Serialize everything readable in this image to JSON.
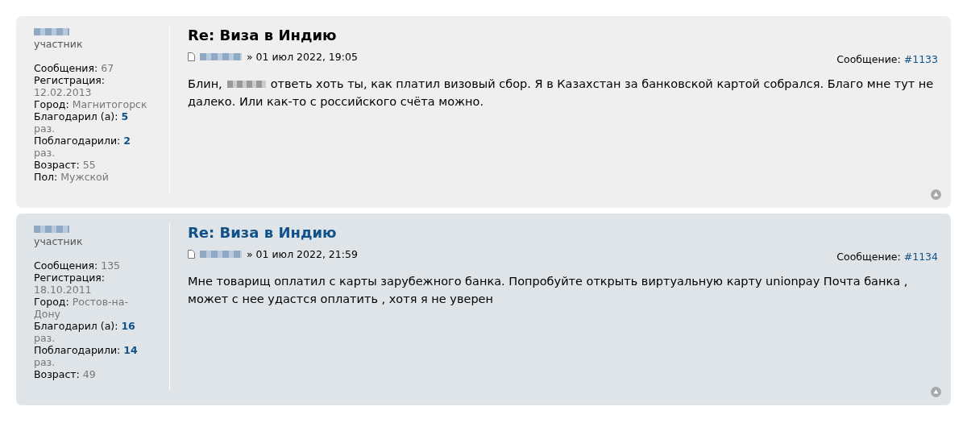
{
  "posts": [
    {
      "kind": "bg1",
      "author": {
        "rank": "участник",
        "fields": [
          {
            "label": "Сообщения:",
            "value": "67"
          },
          {
            "label": "Регистрация:",
            "value": "12.02.2013"
          },
          {
            "label": "Город:",
            "value": "Магнитогорск"
          },
          {
            "label": "Благодарил (а):",
            "value": "5",
            "suffix": "раз.",
            "kind": "count"
          },
          {
            "label": "Поблагодарили:",
            "value": "2",
            "suffix": "раз.",
            "kind": "count"
          },
          {
            "label": "Возраст:",
            "value": "55"
          },
          {
            "label": "Пол:",
            "value": "Мужской"
          }
        ]
      },
      "title": "Re: Виза в Индию",
      "title_link": false,
      "date": "» 01 июл 2022, 19:05",
      "message_label": "Сообщение:",
      "message_number": "#1133",
      "body": {
        "before": "Блин,",
        "mention_redacted": true,
        "after": "ответь хоть ты, как платил визовый сбор. Я в Казахстан за банковской картой собрался. Благо мне тут не далеко. Или как-то с российского счёта можно."
      }
    },
    {
      "kind": "bg2",
      "author": {
        "rank": "участник",
        "fields": [
          {
            "label": "Сообщения:",
            "value": "135"
          },
          {
            "label": "Регистрация:",
            "value": "18.10.2011"
          },
          {
            "label": "Город:",
            "value": "Ростов-на-Дону"
          },
          {
            "label": "Благодарил (а):",
            "value": "16",
            "suffix": "раз.",
            "kind": "count"
          },
          {
            "label": "Поблагодарили:",
            "value": "14",
            "suffix": "раз.",
            "kind": "count"
          },
          {
            "label": "Возраст:",
            "value": "49"
          }
        ]
      },
      "title": "Re: Виза в Индию",
      "title_link": true,
      "date": "» 01 июл 2022, 21:59",
      "message_label": "Сообщение:",
      "message_number": "#1134",
      "body": {
        "before": "Мне товарищ оплатил с карты зарубежного банка. Попробуйте открыть виртуальную карту unionpay Почта банка , может с нее удастся оплатить , хотя я не уверен",
        "mention_redacted": false
      }
    }
  ]
}
